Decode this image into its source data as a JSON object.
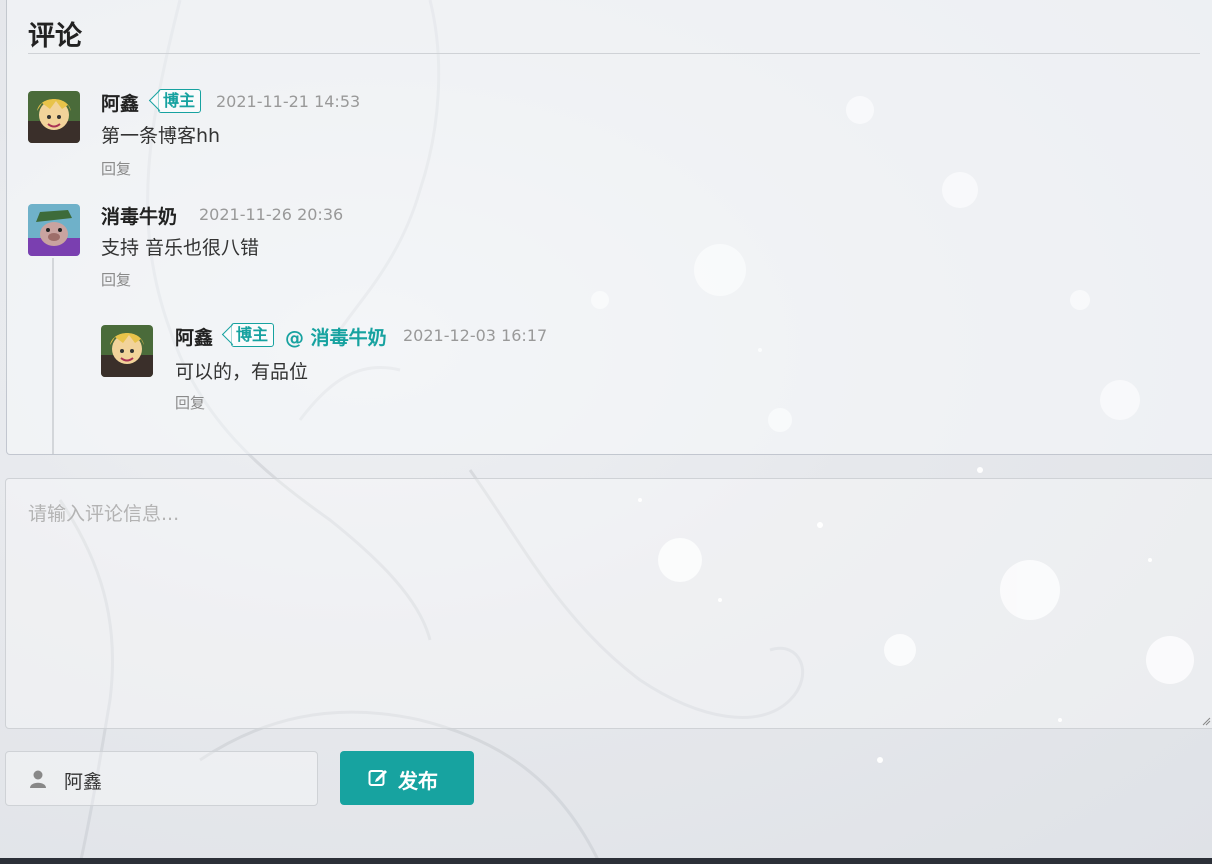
{
  "section": {
    "title": "评论"
  },
  "comments": [
    {
      "author": "阿鑫",
      "badge": "博主",
      "date": "2021-11-21 14:53",
      "text": "第一条博客hh",
      "reply_label": "回复"
    },
    {
      "author": "消毒牛奶",
      "date": "2021-11-26 20:36",
      "text": "支持 音乐也很八错",
      "reply_label": "回复",
      "replies": [
        {
          "author": "阿鑫",
          "badge": "博主",
          "mention": "@ 消毒牛奶",
          "date": "2021-12-03 16:17",
          "text": "可以的，有品位",
          "reply_label": "回复"
        }
      ]
    }
  ],
  "form": {
    "comment_placeholder": "请输入评论信息...",
    "nickname_value": "阿鑫",
    "submit_label": "发布",
    "user_icon": "user-icon",
    "submit_icon": "edit-icon"
  },
  "colors": {
    "accent": "#17a3a0",
    "text": "#333333",
    "muted": "#999999"
  }
}
